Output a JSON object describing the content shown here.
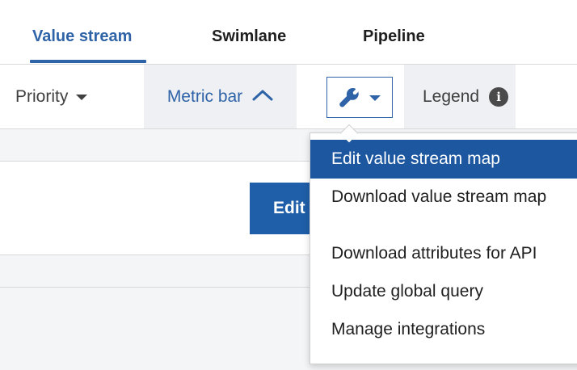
{
  "tabs": [
    {
      "label": "Value stream",
      "active": true
    },
    {
      "label": "Swimlane",
      "active": false
    },
    {
      "label": "Pipeline",
      "active": false
    }
  ],
  "toolbar": {
    "priority_label": "Priority",
    "metric_bar_label": "Metric bar",
    "settings_icon": "wrench-icon",
    "legend_label": "Legend",
    "legend_info_glyph": "i"
  },
  "panel": {
    "edit_button_label": "Edit"
  },
  "menu": {
    "items": [
      "Edit value stream map",
      "Download value stream map",
      "Download attributes for API",
      "Update global query",
      "Manage integrations"
    ]
  },
  "colors": {
    "accent": "#2f63a8",
    "menu_highlight": "#1d57a0",
    "button_bg": "#1f5ea8"
  }
}
